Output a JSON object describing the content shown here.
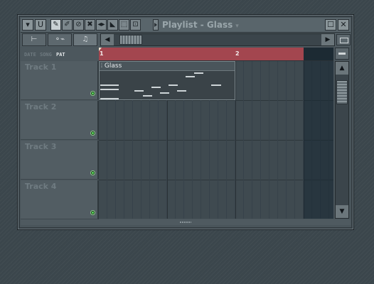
{
  "window": {
    "title": "Playlist - Glass",
    "caret": "▾",
    "menu_icon": "▾",
    "magnet_icon": "U",
    "maximize_icon": "☐",
    "close_icon": "✕"
  },
  "tools": [
    {
      "name": "draw-tool-icon",
      "glyph": "✎"
    },
    {
      "name": "paint-tool-icon",
      "glyph": "✐"
    },
    {
      "name": "delete-tool-icon",
      "glyph": "⊘"
    },
    {
      "name": "mute-tool-icon",
      "glyph": "✖"
    },
    {
      "name": "slip-tool-icon",
      "glyph": "◂▸"
    },
    {
      "name": "slice-tool-icon",
      "glyph": "◣"
    },
    {
      "name": "select-tool-icon",
      "glyph": "⬚"
    },
    {
      "name": "zoom-tool-icon",
      "glyph": "⊡"
    }
  ],
  "modes": [
    {
      "name": "pattern-mode-button",
      "glyph": "⊢"
    },
    {
      "name": "automation-mode-button",
      "glyph": "⚬⌁"
    },
    {
      "name": "audio-mode-button",
      "glyph": "♫"
    }
  ],
  "scroll": {
    "left_arrow": "◀",
    "right_arrow": "▶",
    "up_arrow": "▲",
    "down_arrow": "▼"
  },
  "snap_labels": [
    "DATE",
    "SONG",
    "PAT"
  ],
  "timeline": {
    "bars": [
      "1",
      "2"
    ]
  },
  "tracks": [
    {
      "label": "Track 1"
    },
    {
      "label": "Track 2"
    },
    {
      "label": "Track 3"
    },
    {
      "label": "Track 4"
    }
  ],
  "pattern": {
    "name": "Glass",
    "icon": "⦙"
  }
}
